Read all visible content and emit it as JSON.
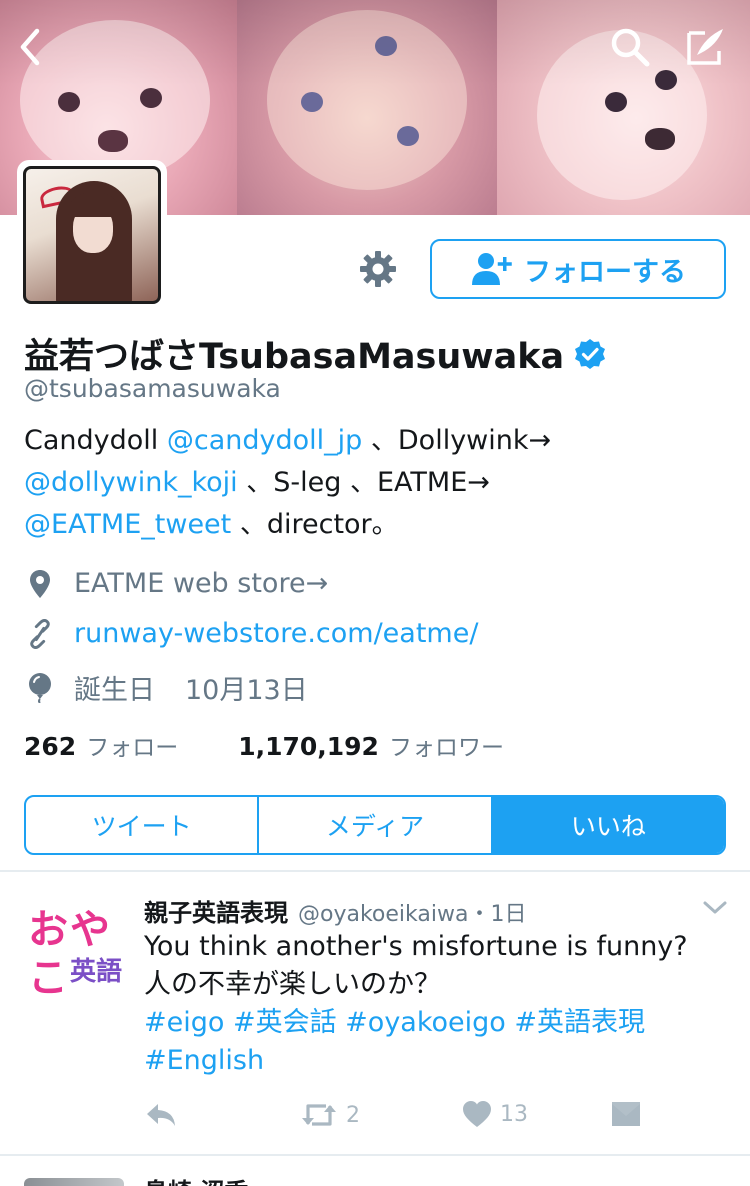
{
  "header": {
    "back_icon": "chevron-left-icon",
    "search_icon": "search-icon",
    "compose_icon": "compose-icon"
  },
  "profile": {
    "display_name": "益若つばさTsubasaMasuwaka",
    "verified": true,
    "handle": "@tsubasamasuwaka",
    "follow_button_label": "フォローする",
    "bio": {
      "line1_text": "Candydoll ",
      "line1_mention": "@candydoll_jp",
      "line1_tail": " 、Dollywink→",
      "line2_mention": "@dollywink_koji",
      "line2_tail": " 、S-leg 、EATME→",
      "line3_mention": "@EATME_tweet",
      "line3_tail": " 、director。"
    },
    "location": "EATME web store→",
    "website": "runway-webstore.com/eatme/",
    "birthday_label": "誕生日",
    "birthday_value": "10月13日"
  },
  "stats": {
    "following_count": "262",
    "following_label": "フォロー",
    "followers_count": "1,170,192",
    "followers_label": "フォロワー"
  },
  "tabs": [
    {
      "label": "ツイート",
      "active": false
    },
    {
      "label": "メディア",
      "active": false
    },
    {
      "label": "いいね",
      "active": true
    }
  ],
  "tweet": {
    "avatar_text_top": "おや",
    "avatar_text_bottom": "こ",
    "avatar_text_small": "英語",
    "author_name": "親子英語表現",
    "author_handle": "@oyakoeikaiwa",
    "time": "・1日",
    "text_line1": "You think another's misfortune is funny?",
    "text_line2": "人の不幸が楽しいのか？",
    "hashtags_line1": "#eigo #英会話 #oyakoeigo #英語表現",
    "hashtags_line2": "#English",
    "retweet_count": "2",
    "like_count": "13"
  },
  "next_tweet": {
    "author_name_partial": "鳥崎 涩香"
  },
  "colors": {
    "accent": "#1da1f2",
    "text": "#14171a",
    "secondary": "#657786",
    "action_gray": "#aab8c2"
  }
}
